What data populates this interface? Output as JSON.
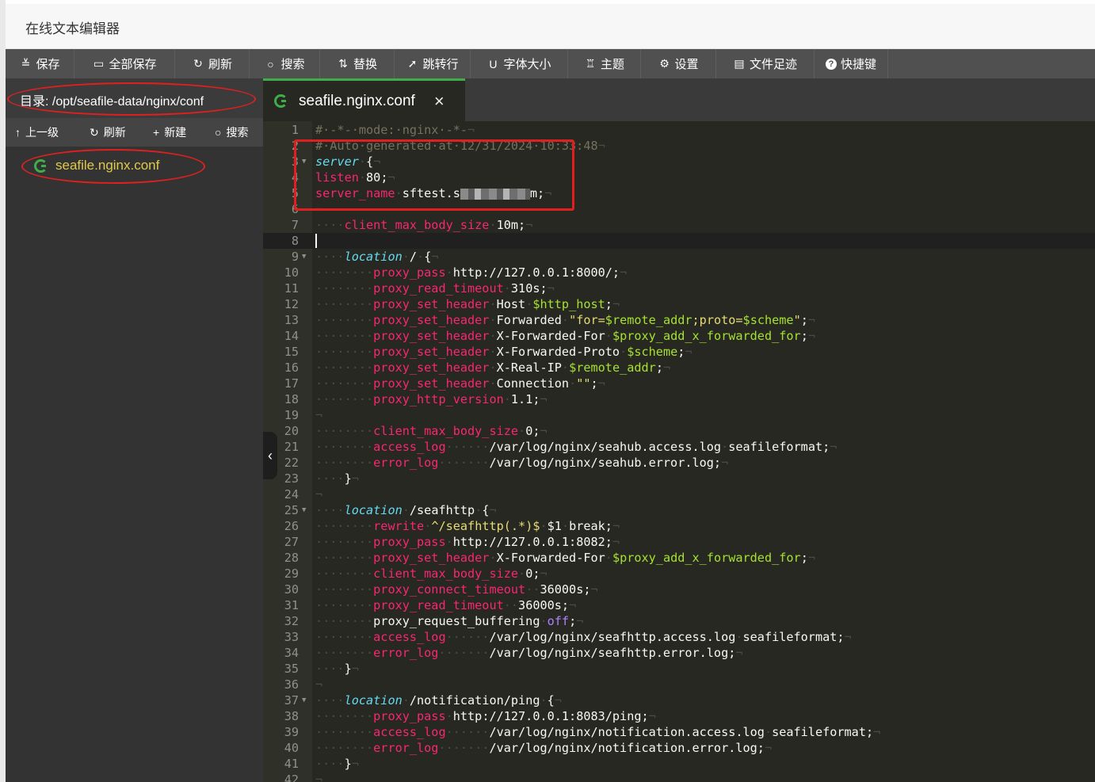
{
  "window": {
    "title": "在线文本编辑器"
  },
  "toolbar": [
    {
      "icon": "save-icon",
      "glyph": "≚",
      "label": "保存"
    },
    {
      "icon": "save-all-icon",
      "glyph": "▭",
      "label": "全部保存"
    },
    {
      "icon": "refresh-icon",
      "glyph": "↻",
      "label": "刷新"
    },
    {
      "icon": "search-icon",
      "glyph": "○",
      "label": "搜索"
    },
    {
      "icon": "replace-icon",
      "glyph": "⇅",
      "label": "替换"
    },
    {
      "icon": "goto-line-icon",
      "glyph": "➚",
      "label": "跳转行"
    },
    {
      "icon": "font-size-icon",
      "glyph": "U",
      "label": "字体大小"
    },
    {
      "icon": "theme-icon",
      "glyph": "♖",
      "label": "主题"
    },
    {
      "icon": "settings-icon",
      "glyph": "⚙",
      "label": "设置"
    },
    {
      "icon": "file-history-icon",
      "glyph": "▤",
      "label": "文件足迹"
    },
    {
      "icon": "help-icon",
      "glyph": "?",
      "label": "快捷键"
    }
  ],
  "sidebar": {
    "directory": "目录: /opt/seafile-data/nginx/conf",
    "tools": [
      {
        "icon": "up-arrow-icon",
        "glyph": "↑",
        "label": "上一级"
      },
      {
        "icon": "refresh-icon",
        "glyph": "↻",
        "label": "刷新"
      },
      {
        "icon": "plus-icon",
        "glyph": "+",
        "label": "新建"
      },
      {
        "icon": "search-icon",
        "glyph": "○",
        "label": "搜索"
      }
    ],
    "files": [
      {
        "name": "seafile.nginx.conf"
      }
    ]
  },
  "tabs": [
    {
      "name": "seafile.nginx.conf",
      "close": "×"
    }
  ],
  "editor": {
    "cursor_line": 8,
    "lines": [
      {
        "n": 1,
        "parts": [
          [
            "c",
            "#·-*-·mode:·nginx·-*-"
          ],
          [
            "pi",
            "¬"
          ]
        ]
      },
      {
        "n": 2,
        "parts": [
          [
            "c",
            "#·Auto·generated·at·12/31/2024·10:33:48"
          ],
          [
            "pi",
            "¬"
          ]
        ]
      },
      {
        "n": 3,
        "fold": true,
        "parts": [
          [
            "k",
            "server"
          ],
          [
            "ws",
            "·"
          ],
          [
            "t",
            "{"
          ],
          [
            "pi",
            "¬"
          ]
        ]
      },
      {
        "n": 4,
        "parts": [
          [
            "p",
            "listen"
          ],
          [
            "ws",
            "·"
          ],
          [
            "t",
            "80;"
          ],
          [
            "pi",
            "¬"
          ]
        ]
      },
      {
        "n": 5,
        "parts": [
          [
            "p",
            "server_name"
          ],
          [
            "ws",
            "·"
          ],
          [
            "t",
            "sftest.s"
          ],
          [
            "blur",
            ""
          ],
          [
            "t",
            "m;"
          ],
          [
            "pi",
            "¬"
          ]
        ]
      },
      {
        "n": 6,
        "parts": [
          [
            "pi",
            "¬"
          ]
        ]
      },
      {
        "n": 7,
        "parts": [
          [
            "ws",
            "····"
          ],
          [
            "p",
            "client_max_body_size"
          ],
          [
            "ws",
            "·"
          ],
          [
            "t",
            "10m;"
          ],
          [
            "pi",
            "¬"
          ]
        ]
      },
      {
        "n": 8,
        "parts": []
      },
      {
        "n": 9,
        "fold": true,
        "parts": [
          [
            "ws",
            "····"
          ],
          [
            "k",
            "location"
          ],
          [
            "ws",
            "·"
          ],
          [
            "t",
            "/"
          ],
          [
            "ws",
            "·"
          ],
          [
            "t",
            "{"
          ],
          [
            "pi",
            "¬"
          ]
        ]
      },
      {
        "n": 10,
        "parts": [
          [
            "ws",
            "········"
          ],
          [
            "p",
            "proxy_pass"
          ],
          [
            "ws",
            "·"
          ],
          [
            "t",
            "http://127.0.0.1:8000/;"
          ],
          [
            "pi",
            "¬"
          ]
        ]
      },
      {
        "n": 11,
        "parts": [
          [
            "ws",
            "········"
          ],
          [
            "p",
            "proxy_read_timeout"
          ],
          [
            "ws",
            "·"
          ],
          [
            "t",
            "310s;"
          ],
          [
            "pi",
            "¬"
          ]
        ]
      },
      {
        "n": 12,
        "parts": [
          [
            "ws",
            "········"
          ],
          [
            "p",
            "proxy_set_header"
          ],
          [
            "ws",
            "·"
          ],
          [
            "t",
            "Host"
          ],
          [
            "ws",
            "·"
          ],
          [
            "v",
            "$http_host"
          ],
          [
            "t",
            ";"
          ],
          [
            "pi",
            "¬"
          ]
        ]
      },
      {
        "n": 13,
        "parts": [
          [
            "ws",
            "········"
          ],
          [
            "p",
            "proxy_set_header"
          ],
          [
            "ws",
            "·"
          ],
          [
            "t",
            "Forwarded"
          ],
          [
            "ws",
            "·"
          ],
          [
            "s",
            "\"for="
          ],
          [
            "v",
            "$remote_addr"
          ],
          [
            "s",
            ";proto="
          ],
          [
            "v",
            "$scheme"
          ],
          [
            "s",
            "\""
          ],
          [
            "t",
            ";"
          ],
          [
            "pi",
            "¬"
          ]
        ]
      },
      {
        "n": 14,
        "parts": [
          [
            "ws",
            "········"
          ],
          [
            "p",
            "proxy_set_header"
          ],
          [
            "ws",
            "·"
          ],
          [
            "t",
            "X-Forwarded-For"
          ],
          [
            "ws",
            "·"
          ],
          [
            "v",
            "$proxy_add_x_forwarded_for"
          ],
          [
            "t",
            ";"
          ],
          [
            "pi",
            "¬"
          ]
        ]
      },
      {
        "n": 15,
        "parts": [
          [
            "ws",
            "········"
          ],
          [
            "p",
            "proxy_set_header"
          ],
          [
            "ws",
            "·"
          ],
          [
            "t",
            "X-Forwarded-Proto"
          ],
          [
            "ws",
            "·"
          ],
          [
            "v",
            "$scheme"
          ],
          [
            "t",
            ";"
          ],
          [
            "pi",
            "¬"
          ]
        ]
      },
      {
        "n": 16,
        "parts": [
          [
            "ws",
            "········"
          ],
          [
            "p",
            "proxy_set_header"
          ],
          [
            "ws",
            "·"
          ],
          [
            "t",
            "X-Real-IP"
          ],
          [
            "ws",
            "·"
          ],
          [
            "v",
            "$remote_addr"
          ],
          [
            "t",
            ";"
          ],
          [
            "pi",
            "¬"
          ]
        ]
      },
      {
        "n": 17,
        "parts": [
          [
            "ws",
            "········"
          ],
          [
            "p",
            "proxy_set_header"
          ],
          [
            "ws",
            "·"
          ],
          [
            "t",
            "Connection"
          ],
          [
            "ws",
            "·"
          ],
          [
            "s",
            "\"\""
          ],
          [
            "t",
            ";"
          ],
          [
            "pi",
            "¬"
          ]
        ]
      },
      {
        "n": 18,
        "parts": [
          [
            "ws",
            "········"
          ],
          [
            "p",
            "proxy_http_version"
          ],
          [
            "ws",
            "·"
          ],
          [
            "t",
            "1.1;"
          ],
          [
            "pi",
            "¬"
          ]
        ]
      },
      {
        "n": 19,
        "parts": [
          [
            "pi",
            "¬"
          ]
        ]
      },
      {
        "n": 20,
        "parts": [
          [
            "ws",
            "········"
          ],
          [
            "p",
            "client_max_body_size"
          ],
          [
            "ws",
            "·"
          ],
          [
            "t",
            "0;"
          ],
          [
            "pi",
            "¬"
          ]
        ]
      },
      {
        "n": 21,
        "parts": [
          [
            "ws",
            "········"
          ],
          [
            "p",
            "access_log"
          ],
          [
            "ws",
            "······"
          ],
          [
            "t",
            "/var/log/nginx/seahub.access.log"
          ],
          [
            "ws",
            "·"
          ],
          [
            "t",
            "seafileformat;"
          ],
          [
            "pi",
            "¬"
          ]
        ]
      },
      {
        "n": 22,
        "parts": [
          [
            "ws",
            "········"
          ],
          [
            "p",
            "error_log"
          ],
          [
            "ws",
            "·······"
          ],
          [
            "t",
            "/var/log/nginx/seahub.error.log;"
          ],
          [
            "pi",
            "¬"
          ]
        ]
      },
      {
        "n": 23,
        "parts": [
          [
            "ws",
            "····"
          ],
          [
            "t",
            "}"
          ],
          [
            "pi",
            "¬"
          ]
        ]
      },
      {
        "n": 24,
        "parts": [
          [
            "pi",
            "¬"
          ]
        ]
      },
      {
        "n": 25,
        "fold": true,
        "parts": [
          [
            "ws",
            "····"
          ],
          [
            "k",
            "location"
          ],
          [
            "ws",
            "·"
          ],
          [
            "t",
            "/seafhttp"
          ],
          [
            "ws",
            "·"
          ],
          [
            "t",
            "{"
          ],
          [
            "pi",
            "¬"
          ]
        ]
      },
      {
        "n": 26,
        "parts": [
          [
            "ws",
            "········"
          ],
          [
            "p",
            "rewrite"
          ],
          [
            "ws",
            "·"
          ],
          [
            "s",
            "^/seafhttp(.*)$"
          ],
          [
            "ws",
            "·"
          ],
          [
            "t",
            "$1"
          ],
          [
            "ws",
            "·"
          ],
          [
            "t",
            "break;"
          ],
          [
            "pi",
            "¬"
          ]
        ]
      },
      {
        "n": 27,
        "parts": [
          [
            "ws",
            "········"
          ],
          [
            "p",
            "proxy_pass"
          ],
          [
            "ws",
            "·"
          ],
          [
            "t",
            "http://127.0.0.1:8082;"
          ],
          [
            "pi",
            "¬"
          ]
        ]
      },
      {
        "n": 28,
        "parts": [
          [
            "ws",
            "········"
          ],
          [
            "p",
            "proxy_set_header"
          ],
          [
            "ws",
            "·"
          ],
          [
            "t",
            "X-Forwarded-For"
          ],
          [
            "ws",
            "·"
          ],
          [
            "v",
            "$proxy_add_x_forwarded_for"
          ],
          [
            "t",
            ";"
          ],
          [
            "pi",
            "¬"
          ]
        ]
      },
      {
        "n": 29,
        "parts": [
          [
            "ws",
            "········"
          ],
          [
            "p",
            "client_max_body_size"
          ],
          [
            "ws",
            "·"
          ],
          [
            "t",
            "0;"
          ],
          [
            "pi",
            "¬"
          ]
        ]
      },
      {
        "n": 30,
        "parts": [
          [
            "ws",
            "········"
          ],
          [
            "p",
            "proxy_connect_timeout"
          ],
          [
            "ws",
            "··"
          ],
          [
            "t",
            "36000s;"
          ],
          [
            "pi",
            "¬"
          ]
        ]
      },
      {
        "n": 31,
        "parts": [
          [
            "ws",
            "········"
          ],
          [
            "p",
            "proxy_read_timeout"
          ],
          [
            "ws",
            "··"
          ],
          [
            "t",
            "36000s;"
          ],
          [
            "pi",
            "¬"
          ]
        ]
      },
      {
        "n": 32,
        "parts": [
          [
            "ws",
            "········"
          ],
          [
            "t",
            "proxy_request_buffering"
          ],
          [
            "ws",
            "·"
          ],
          [
            "o",
            "off"
          ],
          [
            "t",
            ";"
          ],
          [
            "pi",
            "¬"
          ]
        ]
      },
      {
        "n": 33,
        "parts": [
          [
            "ws",
            "········"
          ],
          [
            "p",
            "access_log"
          ],
          [
            "ws",
            "······"
          ],
          [
            "t",
            "/var/log/nginx/seafhttp.access.log"
          ],
          [
            "ws",
            "·"
          ],
          [
            "t",
            "seafileformat;"
          ],
          [
            "pi",
            "¬"
          ]
        ]
      },
      {
        "n": 34,
        "parts": [
          [
            "ws",
            "········"
          ],
          [
            "p",
            "error_log"
          ],
          [
            "ws",
            "·······"
          ],
          [
            "t",
            "/var/log/nginx/seafhttp.error.log;"
          ],
          [
            "pi",
            "¬"
          ]
        ]
      },
      {
        "n": 35,
        "parts": [
          [
            "ws",
            "····"
          ],
          [
            "t",
            "}"
          ],
          [
            "pi",
            "¬"
          ]
        ]
      },
      {
        "n": 36,
        "parts": [
          [
            "pi",
            "¬"
          ]
        ]
      },
      {
        "n": 37,
        "fold": true,
        "parts": [
          [
            "ws",
            "····"
          ],
          [
            "k",
            "location"
          ],
          [
            "ws",
            "·"
          ],
          [
            "t",
            "/notification/ping"
          ],
          [
            "ws",
            "·"
          ],
          [
            "t",
            "{"
          ],
          [
            "pi",
            "¬"
          ]
        ]
      },
      {
        "n": 38,
        "parts": [
          [
            "ws",
            "········"
          ],
          [
            "p",
            "proxy_pass"
          ],
          [
            "ws",
            "·"
          ],
          [
            "t",
            "http://127.0.0.1:8083/ping;"
          ],
          [
            "pi",
            "¬"
          ]
        ]
      },
      {
        "n": 39,
        "parts": [
          [
            "ws",
            "········"
          ],
          [
            "p",
            "access_log"
          ],
          [
            "ws",
            "······"
          ],
          [
            "t",
            "/var/log/nginx/notification.access.log"
          ],
          [
            "ws",
            "·"
          ],
          [
            "t",
            "seafileformat;"
          ],
          [
            "pi",
            "¬"
          ]
        ]
      },
      {
        "n": 40,
        "parts": [
          [
            "ws",
            "········"
          ],
          [
            "p",
            "error_log"
          ],
          [
            "ws",
            "·······"
          ],
          [
            "t",
            "/var/log/nginx/notification.error.log;"
          ],
          [
            "pi",
            "¬"
          ]
        ]
      },
      {
        "n": 41,
        "parts": [
          [
            "ws",
            "····"
          ],
          [
            "t",
            "}"
          ],
          [
            "pi",
            "¬"
          ]
        ]
      },
      {
        "n": 42,
        "parts": [
          [
            "pi",
            "¬"
          ]
        ]
      }
    ]
  },
  "theme": {
    "editor_bg": "#272822",
    "comment": "#75715e",
    "keyword": "#66d9ef",
    "property": "#f92672",
    "variable": "#a6e22e",
    "string": "#e6db74",
    "constant": "#ae81ff",
    "tab_accent": "#3fae49",
    "file_color": "#e0c94b",
    "annotation": "#e02020"
  },
  "collapse_handle": {
    "glyph": "‹"
  }
}
